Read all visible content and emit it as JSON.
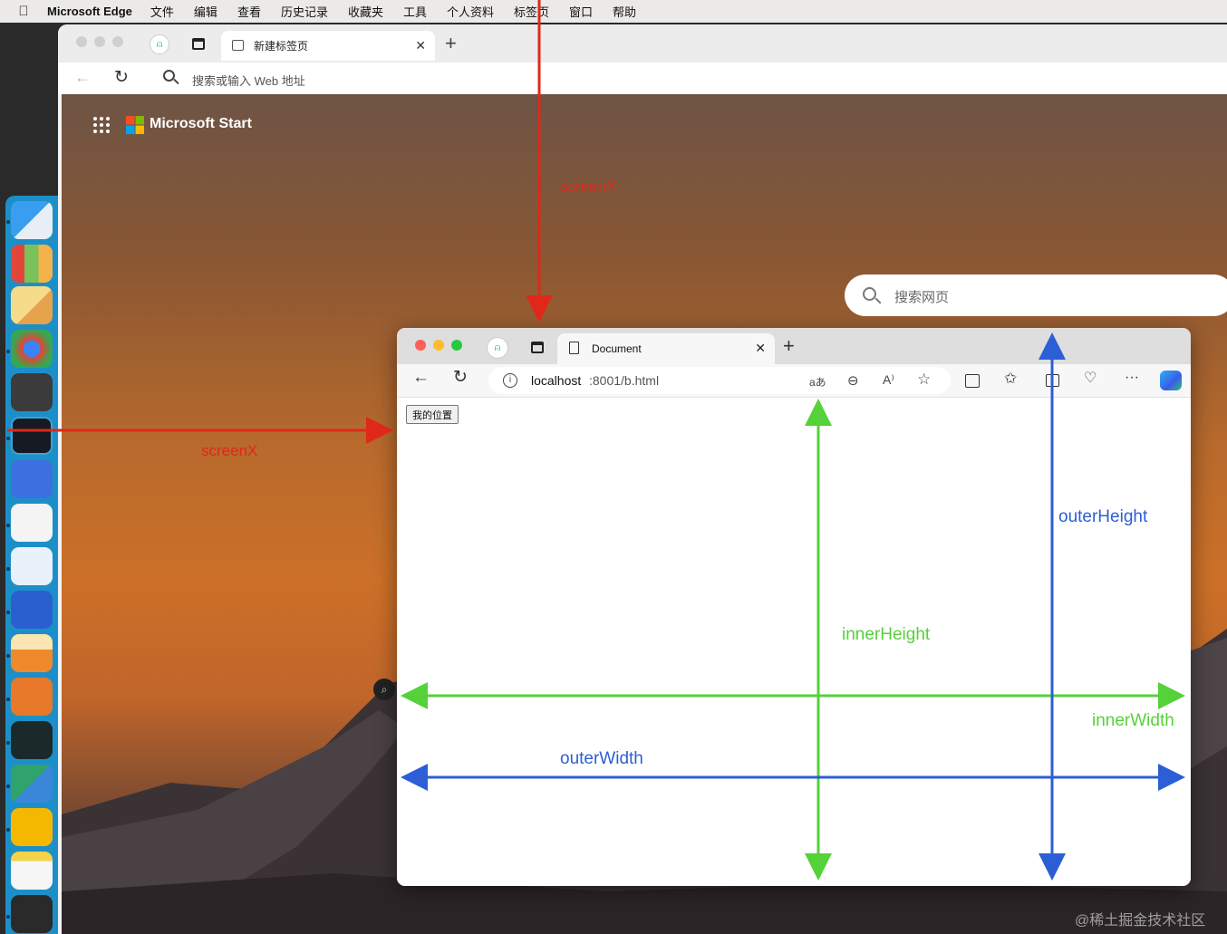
{
  "menubar": {
    "apple_icon": "apple-icon",
    "app_name": "Microsoft Edge",
    "items": [
      "文件",
      "编辑",
      "查看",
      "历史记录",
      "收藏夹",
      "工具",
      "个人资料",
      "标签页",
      "窗口",
      "帮助"
    ]
  },
  "outer_browser": {
    "tab_title": "新建标签页",
    "address_placeholder": "搜索或输入 Web 地址",
    "brand": "Microsoft Start",
    "search_placeholder": "搜索网页"
  },
  "inner_browser": {
    "tab_title": "Document",
    "url_host": "localhost",
    "url_rest": ":8001/b.html",
    "read_aloud_label": "aあ",
    "page_button": "我的位置"
  },
  "annotations": {
    "screenY": "screenY",
    "screenX": "screenX",
    "innerHeight": "innerHeight",
    "outerHeight": "outerHeight",
    "innerWidth": "innerWidth",
    "outerWidth": "outerWidth"
  },
  "colors": {
    "red": "#e0281a",
    "green": "#55d13a",
    "blue": "#2c5fd6"
  },
  "watermark": "@稀土掘金技术社区"
}
